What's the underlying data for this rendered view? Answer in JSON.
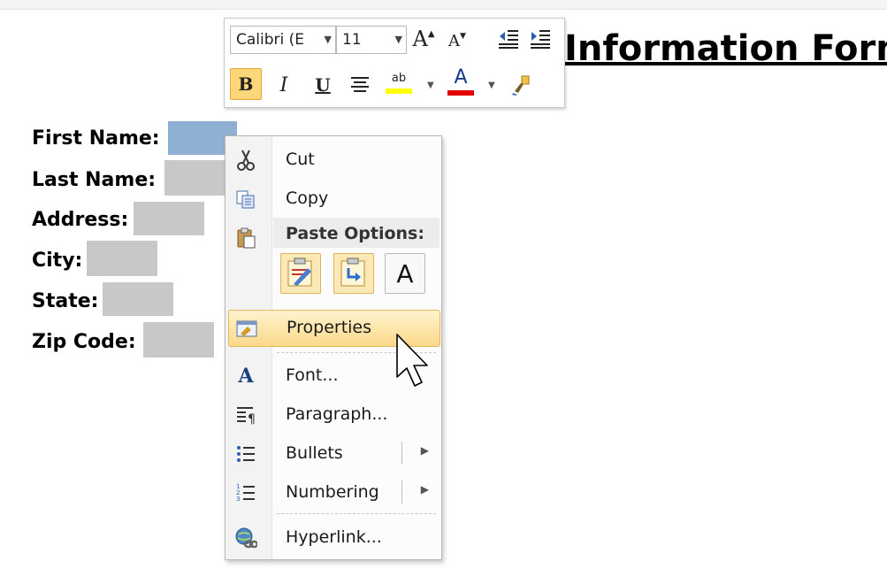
{
  "document": {
    "title": "Information Form",
    "form_fields": [
      {
        "label": "First Name:"
      },
      {
        "label": "Last Name:"
      },
      {
        "label": "Address:"
      },
      {
        "label": "City:"
      },
      {
        "label": "State:"
      },
      {
        "label": "Zip Code:"
      }
    ]
  },
  "mini_toolbar": {
    "font_name": "Calibri (E",
    "font_size": "11",
    "grow_font": "A",
    "shrink_font": "A",
    "bold": "B",
    "italic": "I",
    "underline": "U",
    "highlight_text": "ab",
    "font_color_letter": "A",
    "colors": {
      "highlight": "#ffff00",
      "font_color": "#e00000",
      "bold_active": "#fbd77a"
    }
  },
  "context_menu": {
    "cut": "Cut",
    "copy": "Copy",
    "paste_options_header": "Paste Options:",
    "paste_text_only": "A",
    "properties": "Properties",
    "font_icon": "A",
    "font": "Font...",
    "paragraph": "Paragraph...",
    "bullets": "Bullets",
    "numbering": "Numbering",
    "hyperlink": "Hyperlink..."
  }
}
